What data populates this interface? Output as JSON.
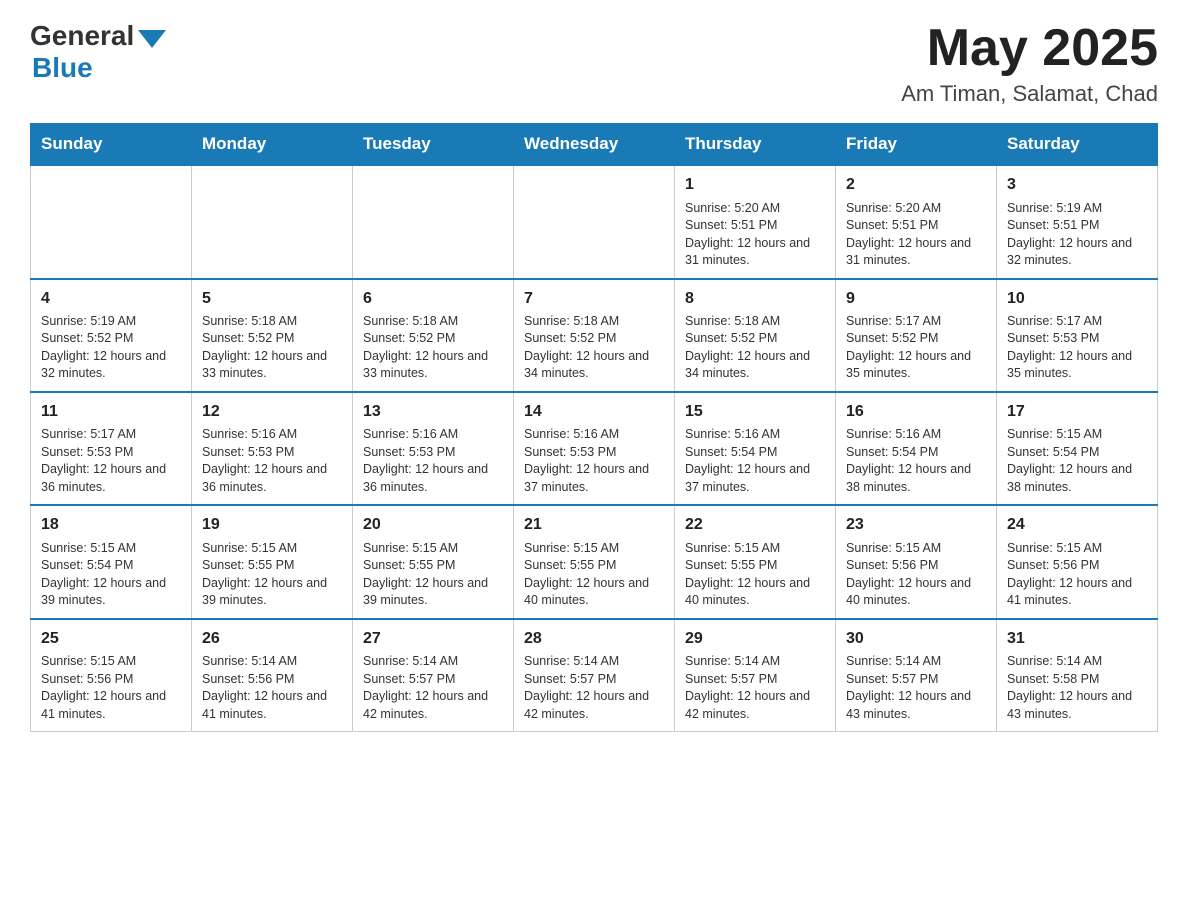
{
  "header": {
    "logo_general": "General",
    "logo_blue": "Blue",
    "month_year": "May 2025",
    "location": "Am Timan, Salamat, Chad"
  },
  "days_of_week": [
    "Sunday",
    "Monday",
    "Tuesday",
    "Wednesday",
    "Thursday",
    "Friday",
    "Saturday"
  ],
  "weeks": [
    {
      "days": [
        {
          "number": "",
          "info": ""
        },
        {
          "number": "",
          "info": ""
        },
        {
          "number": "",
          "info": ""
        },
        {
          "number": "",
          "info": ""
        },
        {
          "number": "1",
          "info": "Sunrise: 5:20 AM\nSunset: 5:51 PM\nDaylight: 12 hours and 31 minutes."
        },
        {
          "number": "2",
          "info": "Sunrise: 5:20 AM\nSunset: 5:51 PM\nDaylight: 12 hours and 31 minutes."
        },
        {
          "number": "3",
          "info": "Sunrise: 5:19 AM\nSunset: 5:51 PM\nDaylight: 12 hours and 32 minutes."
        }
      ]
    },
    {
      "days": [
        {
          "number": "4",
          "info": "Sunrise: 5:19 AM\nSunset: 5:52 PM\nDaylight: 12 hours and 32 minutes."
        },
        {
          "number": "5",
          "info": "Sunrise: 5:18 AM\nSunset: 5:52 PM\nDaylight: 12 hours and 33 minutes."
        },
        {
          "number": "6",
          "info": "Sunrise: 5:18 AM\nSunset: 5:52 PM\nDaylight: 12 hours and 33 minutes."
        },
        {
          "number": "7",
          "info": "Sunrise: 5:18 AM\nSunset: 5:52 PM\nDaylight: 12 hours and 34 minutes."
        },
        {
          "number": "8",
          "info": "Sunrise: 5:18 AM\nSunset: 5:52 PM\nDaylight: 12 hours and 34 minutes."
        },
        {
          "number": "9",
          "info": "Sunrise: 5:17 AM\nSunset: 5:52 PM\nDaylight: 12 hours and 35 minutes."
        },
        {
          "number": "10",
          "info": "Sunrise: 5:17 AM\nSunset: 5:53 PM\nDaylight: 12 hours and 35 minutes."
        }
      ]
    },
    {
      "days": [
        {
          "number": "11",
          "info": "Sunrise: 5:17 AM\nSunset: 5:53 PM\nDaylight: 12 hours and 36 minutes."
        },
        {
          "number": "12",
          "info": "Sunrise: 5:16 AM\nSunset: 5:53 PM\nDaylight: 12 hours and 36 minutes."
        },
        {
          "number": "13",
          "info": "Sunrise: 5:16 AM\nSunset: 5:53 PM\nDaylight: 12 hours and 36 minutes."
        },
        {
          "number": "14",
          "info": "Sunrise: 5:16 AM\nSunset: 5:53 PM\nDaylight: 12 hours and 37 minutes."
        },
        {
          "number": "15",
          "info": "Sunrise: 5:16 AM\nSunset: 5:54 PM\nDaylight: 12 hours and 37 minutes."
        },
        {
          "number": "16",
          "info": "Sunrise: 5:16 AM\nSunset: 5:54 PM\nDaylight: 12 hours and 38 minutes."
        },
        {
          "number": "17",
          "info": "Sunrise: 5:15 AM\nSunset: 5:54 PM\nDaylight: 12 hours and 38 minutes."
        }
      ]
    },
    {
      "days": [
        {
          "number": "18",
          "info": "Sunrise: 5:15 AM\nSunset: 5:54 PM\nDaylight: 12 hours and 39 minutes."
        },
        {
          "number": "19",
          "info": "Sunrise: 5:15 AM\nSunset: 5:55 PM\nDaylight: 12 hours and 39 minutes."
        },
        {
          "number": "20",
          "info": "Sunrise: 5:15 AM\nSunset: 5:55 PM\nDaylight: 12 hours and 39 minutes."
        },
        {
          "number": "21",
          "info": "Sunrise: 5:15 AM\nSunset: 5:55 PM\nDaylight: 12 hours and 40 minutes."
        },
        {
          "number": "22",
          "info": "Sunrise: 5:15 AM\nSunset: 5:55 PM\nDaylight: 12 hours and 40 minutes."
        },
        {
          "number": "23",
          "info": "Sunrise: 5:15 AM\nSunset: 5:56 PM\nDaylight: 12 hours and 40 minutes."
        },
        {
          "number": "24",
          "info": "Sunrise: 5:15 AM\nSunset: 5:56 PM\nDaylight: 12 hours and 41 minutes."
        }
      ]
    },
    {
      "days": [
        {
          "number": "25",
          "info": "Sunrise: 5:15 AM\nSunset: 5:56 PM\nDaylight: 12 hours and 41 minutes."
        },
        {
          "number": "26",
          "info": "Sunrise: 5:14 AM\nSunset: 5:56 PM\nDaylight: 12 hours and 41 minutes."
        },
        {
          "number": "27",
          "info": "Sunrise: 5:14 AM\nSunset: 5:57 PM\nDaylight: 12 hours and 42 minutes."
        },
        {
          "number": "28",
          "info": "Sunrise: 5:14 AM\nSunset: 5:57 PM\nDaylight: 12 hours and 42 minutes."
        },
        {
          "number": "29",
          "info": "Sunrise: 5:14 AM\nSunset: 5:57 PM\nDaylight: 12 hours and 42 minutes."
        },
        {
          "number": "30",
          "info": "Sunrise: 5:14 AM\nSunset: 5:57 PM\nDaylight: 12 hours and 43 minutes."
        },
        {
          "number": "31",
          "info": "Sunrise: 5:14 AM\nSunset: 5:58 PM\nDaylight: 12 hours and 43 minutes."
        }
      ]
    }
  ]
}
